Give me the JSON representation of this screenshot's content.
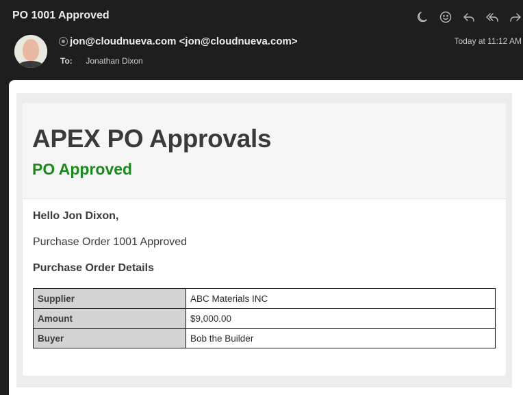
{
  "header": {
    "subject": "PO 1001 Approved",
    "from": "jon@cloudnueva.com <jon@cloudnueva.com>",
    "to_label": "To:",
    "to": "Jonathan Dixon",
    "timestamp": "Today at 11:12 AM",
    "toolbar": [
      {
        "name": "snooze",
        "icon": "moon-icon"
      },
      {
        "name": "reaction",
        "icon": "smiley-icon"
      },
      {
        "name": "reply",
        "icon": "reply-icon"
      },
      {
        "name": "reply-all",
        "icon": "reply-all-icon"
      },
      {
        "name": "forward",
        "icon": "forward-icon"
      }
    ]
  },
  "email": {
    "app_title": "APEX PO Approvals",
    "status": "PO Approved",
    "greeting": "Hello Jon Dixon,",
    "message": "Purchase Order 1001 Approved",
    "details_heading": "Purchase Order Details",
    "details": [
      {
        "label": "Supplier",
        "value": "ABC Materials INC"
      },
      {
        "label": "Amount",
        "value": "$9,000.00"
      },
      {
        "label": "Buyer",
        "value": "Bob the Builder"
      }
    ]
  },
  "colors": {
    "status_green": "#1a8a1a",
    "header_bg": "#1e1e1e",
    "label_cell_bg": "#d3d3d3"
  }
}
